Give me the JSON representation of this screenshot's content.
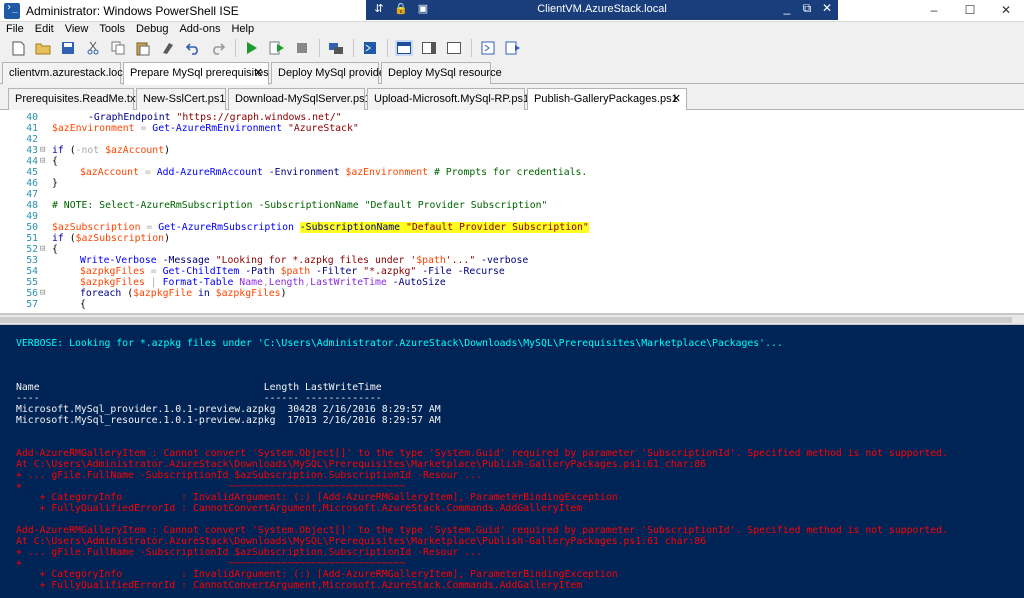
{
  "window": {
    "title": "Administrator: Windows PowerShell ISE",
    "minimize": "–",
    "maximize": "☐",
    "close": "✕"
  },
  "rdp": {
    "title": "ClientVM.AzureStack.local",
    "left_icons": [
      "⇵",
      "🔒",
      "▣"
    ],
    "right_icons": [
      "_",
      "⧉",
      "✕"
    ]
  },
  "menu": [
    "File",
    "Edit",
    "View",
    "Tools",
    "Debug",
    "Add-ons",
    "Help"
  ],
  "toolbar": {
    "icons": [
      "new-file-icon",
      "open-file-icon",
      "save-icon",
      "cut-icon",
      "copy-icon",
      "paste-icon",
      "clear-icon",
      "undo-icon",
      "redo-icon",
      "run-icon",
      "run-selection-icon",
      "stop-icon",
      "remote-tab-icon",
      "powershell-icon",
      "layout-top-icon",
      "layout-right-icon",
      "layout-max-icon",
      "show-commands-icon",
      "show-addons-icon"
    ]
  },
  "session_tabs": [
    {
      "label": "clientvm.azurestack.local",
      "active": false
    },
    {
      "label": "Prepare MySql prerequisites",
      "active": true
    },
    {
      "label": "Deploy MySql provider",
      "active": false
    },
    {
      "label": "Deploy MySql resource",
      "active": false
    }
  ],
  "script_tabs": [
    {
      "label": "Prerequisites.ReadMe.txt",
      "active": false
    },
    {
      "label": "New-SslCert.ps1",
      "active": false
    },
    {
      "label": "Download-MySqlServer.ps1",
      "active": false
    },
    {
      "label": "Upload-Microsoft.MySql-RP.ps1",
      "active": false
    },
    {
      "label": "Publish-GalleryPackages.ps1",
      "active": true
    }
  ],
  "editor": {
    "line_numbers": [
      "40",
      "41",
      "42",
      "43",
      "44",
      "45",
      "46",
      "47",
      "48",
      "49",
      "50",
      "51",
      "52",
      "53",
      "54",
      "55",
      "56",
      "57"
    ],
    "lines": {
      "l40a": "-GraphEndpoint",
      "l40b": "\"https://graph.windows.net/\"",
      "l41a": "$azEnvironment",
      "l41b": "=",
      "l41c": "Get-AzureRmEnvironment",
      "l41d": "\"AzureStack\"",
      "l43a": "if",
      "l43b": "(",
      "l43c": "-not",
      "l43d": "$azAccount",
      "l43e": ")",
      "l44": "{",
      "l45a": "$azAccount",
      "l45b": "=",
      "l45c": "Add-AzureRmAccount",
      "l45d": "-Environment",
      "l45e": "$azEnvironment",
      "l45f": "# Prompts for credentials.",
      "l46": "}",
      "l48": "# NOTE: Select-AzureRmSubscription -SubscriptionName \"Default Provider Subscription\"",
      "l50a": "$azSubscription",
      "l50b": "=",
      "l50c": "Get-AzureRmSubscription",
      "l50d": "-SubscriptionName",
      "l50e": "\"Default Provider Subscription\"",
      "l51a": "if",
      "l51b": "(",
      "l51c": "$azSubscription",
      "l51d": ")",
      "l52": "{",
      "l53a": "Write-Verbose",
      "l53b": "-Message",
      "l53c": "\"Looking for *.azpkg files under '",
      "l53d": "$path",
      "l53e": "'...\"",
      "l53f": "-verbose",
      "l54a": "$azpkgFiles",
      "l54b": "=",
      "l54c": "Get-ChildItem",
      "l54d": "-Path",
      "l54e": "$path",
      "l54f": "-Filter",
      "l54g": "\"*.azpkg\"",
      "l54h": "-File",
      "l54i": "-Recurse",
      "l55a": "$azpkgFiles",
      "l55b": "|",
      "l55c": "Format-Table",
      "l55d": "Name",
      "l55e": ",",
      "l55f": "Length",
      "l55g": ",",
      "l55h": "LastWriteTime",
      "l55i": "-AutoSize",
      "l56a": "foreach",
      "l56b": "(",
      "l56c": "$azpkgFile",
      "l56d": "in",
      "l56e": "$azpkgFiles",
      "l56f": ")",
      "l57": "{"
    }
  },
  "console": {
    "verbose": "VERBOSE: Looking for *.azpkg files under 'C:\\Users\\Administrator.AzureStack\\Downloads\\MySQL\\Prerequisites\\Marketplace\\Packages'...",
    "table_header": "Name                                      Length LastWriteTime",
    "table_rule": "----                                      ------ -------------",
    "rows": [
      "Microsoft.MySql_provider.1.0.1-preview.azpkg  30428 2/16/2016 8:29:57 AM",
      "Microsoft.MySql_resource.1.0.1-preview.azpkg  17013 2/16/2016 8:29:57 AM"
    ],
    "error1": [
      "Add-AzureRMGalleryItem : Cannot convert 'System.Object[]' to the type 'System.Guid' required by parameter 'SubscriptionId'. Specified method is not supported.",
      "At C:\\Users\\Administrator.AzureStack\\Downloads\\MySQL\\Prerequisites\\Marketplace\\Publish-GalleryPackages.ps1:61 char:86",
      "+ ... gFile.FullName -SubscriptionId $azSubscription.SubscriptionId -Resour ...",
      "+                                   ~~~~~~~~~~~~~~~~~~~~~~~~~~~~~~",
      "    + CategoryInfo          : InvalidArgument: (:) [Add-AzureRMGalleryItem], ParameterBindingException",
      "    + FullyQualifiedErrorId : CannotConvertArgument,Microsoft.AzureStack.Commands.AddGalleryItem"
    ],
    "error2": [
      "Add-AzureRMGalleryItem : Cannot convert 'System.Object[]' to the type 'System.Guid' required by parameter 'SubscriptionId'. Specified method is not supported.",
      "At C:\\Users\\Administrator.AzureStack\\Downloads\\MySQL\\Prerequisites\\Marketplace\\Publish-GalleryPackages.ps1:61 char:86",
      "+ ... gFile.FullName -SubscriptionId $azSubscription.SubscriptionId -Resour ...",
      "+                                   ~~~~~~~~~~~~~~~~~~~~~~~~~~~~~~",
      "    + CategoryInfo          : InvalidArgument: (:) [Add-AzureRMGalleryItem], ParameterBindingException",
      "    + FullyQualifiedErrorId : CannotConvertArgument,Microsoft.AzureStack.Commands.AddGalleryItem"
    ]
  },
  "colors": {
    "console_bg": "#012456",
    "verbose": "#00ffff",
    "error": "#ff0000",
    "highlight": "#ffff22"
  }
}
